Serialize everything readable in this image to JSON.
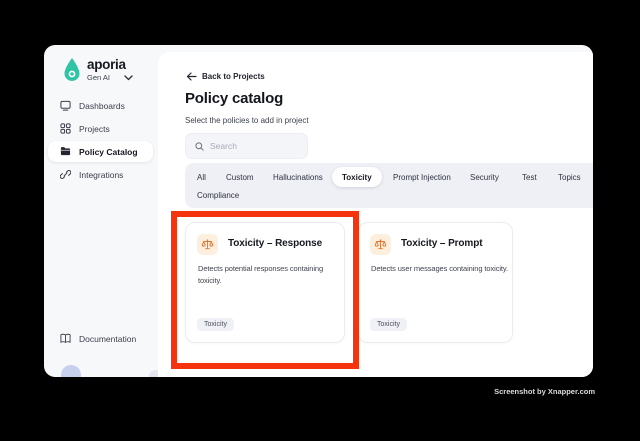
{
  "brand": {
    "name": "aporia",
    "workspace": "Gen AI"
  },
  "sidebar": {
    "items": [
      {
        "label": "Dashboards",
        "icon": "dashboard-icon"
      },
      {
        "label": "Projects",
        "icon": "projects-grid-icon"
      },
      {
        "label": "Policy Catalog",
        "icon": "folder-icon",
        "active": true
      },
      {
        "label": "Integrations",
        "icon": "link-icon"
      }
    ],
    "footer": {
      "label": "Documentation",
      "icon": "book-icon"
    }
  },
  "main": {
    "back_link": "Back to Projects",
    "title": "Policy catalog",
    "subtitle": "Select the policies to add in project",
    "search": {
      "placeholder": "Search"
    },
    "tabs": {
      "selected": "Toxicity",
      "row1": [
        "All",
        "Custom",
        "Hallucinations",
        "Toxicity",
        "Prompt Injection",
        "Security",
        "Test",
        "Topics"
      ],
      "row2": [
        "Compliance"
      ]
    },
    "cards": [
      {
        "icon": "scales-icon",
        "title": "Toxicity – Response",
        "description": "Detects potential responses containing toxicity.",
        "tag": "Toxicity"
      },
      {
        "icon": "scales-icon",
        "title": "Toxicity – Prompt",
        "description": "Detects user messages containing toxicity.",
        "tag": "Toxicity"
      }
    ]
  },
  "annotation": {
    "type": "highlight-box",
    "color": "#f5330f"
  },
  "watermark": "Screenshot by Xnapper.com",
  "colors": {
    "background": "#000000",
    "window_bg": "#f7f8fa",
    "panel_bg": "#ffffff",
    "accent_teal": "#2fc4a3",
    "annotation_red": "#f5330f",
    "icon_orange": "#e2742e",
    "icon_bg": "#fdefde",
    "tabs_bg": "#eef0f6"
  }
}
